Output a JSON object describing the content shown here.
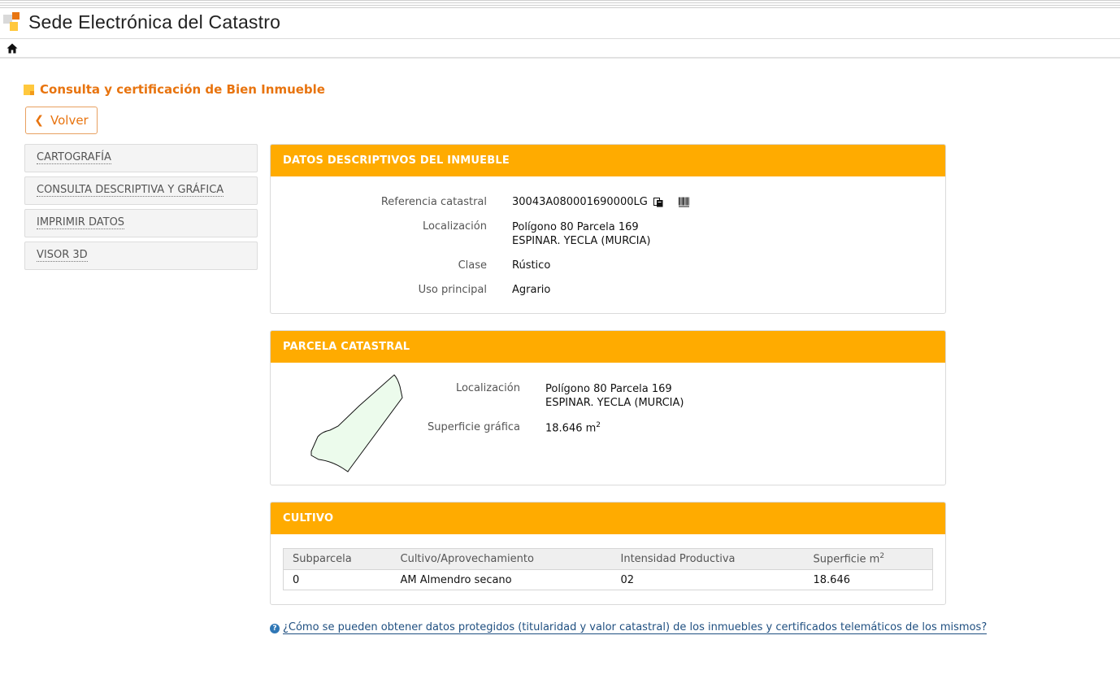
{
  "header": {
    "site_title": "Sede Electrónica del Catastro"
  },
  "page": {
    "heading": "Consulta y certificación de Bien Inmueble",
    "back_label": "Volver"
  },
  "sidebar": {
    "items": [
      {
        "label": "CARTOGRAFÍA"
      },
      {
        "label": "CONSULTA DESCRIPTIVA Y GRÁFICA"
      },
      {
        "label": "IMPRIMIR DATOS"
      },
      {
        "label": "VISOR 3D"
      }
    ]
  },
  "descriptive": {
    "title": "DATOS DESCRIPTIVOS DEL INMUEBLE",
    "ref_label": "Referencia catastral",
    "ref_value": "30043A080001690000LG",
    "loc_label": "Localización",
    "loc_line1": "Polígono 80 Parcela 169",
    "loc_line2": "ESPINAR. YECLA (MURCIA)",
    "clase_label": "Clase",
    "clase_value": "Rústico",
    "uso_label": "Uso principal",
    "uso_value": "Agrario"
  },
  "parcel": {
    "title": "PARCELA CATASTRAL",
    "loc_label": "Localización",
    "loc_line1": "Polígono 80 Parcela 169",
    "loc_line2": "ESPINAR. YECLA (MURCIA)",
    "area_label": "Superficie gráfica",
    "area_value": "18.646 m",
    "area_sup": "2"
  },
  "crop": {
    "title": "CULTIVO",
    "headers": [
      "Subparcela",
      "Cultivo/Aprovechamiento",
      "Intensidad Productiva",
      "Superficie m"
    ],
    "header_sup": "2",
    "rows": [
      {
        "subparcela": "0",
        "cultivo": "AM Almendro secano",
        "intensidad": "02",
        "superficie": "18.646"
      }
    ]
  },
  "footer": {
    "link_text": "¿Cómo se pueden obtener datos protegidos (titularidad y valor catastral) de los inmuebles y certificados telemáticos de los mismos?"
  },
  "icons": {
    "home": "home-icon",
    "copy": "copy-icon",
    "barcode": "barcode-icon",
    "help": "question-circle-icon",
    "back": "chevron-left-icon"
  },
  "colors": {
    "accent_orange": "#ffab00",
    "heading_orange": "#e8740f",
    "link_blue": "#1f4f80",
    "parcel_fill": "#ecfbec"
  }
}
